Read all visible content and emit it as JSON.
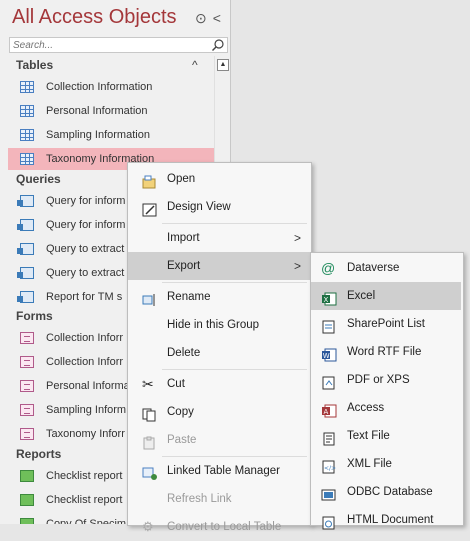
{
  "nav": {
    "title": "All Access Objects",
    "header_icons": [
      "⊙",
      "<"
    ],
    "search": {
      "placeholder": "Search...",
      "value": ""
    },
    "groups": {
      "tables": {
        "label": "Tables",
        "items": [
          "Collection Information",
          "Personal Information",
          "Sampling Information",
          "Taxonomy Information"
        ]
      },
      "queries": {
        "label": "Queries",
        "items": [
          "Query for inform",
          "Query for inform",
          "Query to extract",
          "Query to extract",
          "Report for TM s"
        ]
      },
      "forms": {
        "label": "Forms",
        "items": [
          "Collection Inforr",
          "Collection Inforr",
          "Personal Informa",
          "Sampling Inform",
          "Taxonomy Inforr"
        ]
      },
      "reports": {
        "label": "Reports",
        "items": [
          "Checklist report",
          "Checklist report",
          "Copy Of Specim"
        ]
      }
    }
  },
  "context_menu": {
    "items": [
      {
        "icon": "open-icon",
        "label": "Open"
      },
      {
        "icon": "design-view-icon",
        "label": "Design View"
      },
      {
        "label": "Import"
      },
      {
        "label": "Export"
      },
      {
        "icon": "rename-icon",
        "label": "Rename"
      },
      {
        "label": "Hide in this Group"
      },
      {
        "label": "Delete"
      },
      {
        "icon": "cut-icon",
        "label": "Cut"
      },
      {
        "icon": "copy-icon",
        "label": "Copy"
      },
      {
        "icon": "paste-icon",
        "label": "Paste"
      },
      {
        "icon": "linked-table-manager-icon",
        "label": "Linked Table Manager"
      },
      {
        "label": "Refresh Link"
      },
      {
        "label": "Convert to Local Table"
      }
    ]
  },
  "export_menu": {
    "items": [
      {
        "icon": "dataverse-icon",
        "label": "Dataverse"
      },
      {
        "icon": "excel-icon",
        "label": "Excel"
      },
      {
        "icon": "sharepoint-list-icon",
        "label": "SharePoint List"
      },
      {
        "icon": "word-rtf-icon",
        "label": "Word RTF File"
      },
      {
        "icon": "pdf-xps-icon",
        "label": "PDF or XPS"
      },
      {
        "icon": "access-icon",
        "label": "Access"
      },
      {
        "icon": "text-file-icon",
        "label": "Text File"
      },
      {
        "icon": "xml-file-icon",
        "label": "XML File"
      },
      {
        "icon": "odbc-database-icon",
        "label": "ODBC Database"
      },
      {
        "icon": "html-document-icon",
        "label": "HTML Document"
      }
    ]
  },
  "colors": {
    "title": "#a4373a",
    "selected_item": "#f3b5bb",
    "menu_active": "#cfcfcf"
  }
}
